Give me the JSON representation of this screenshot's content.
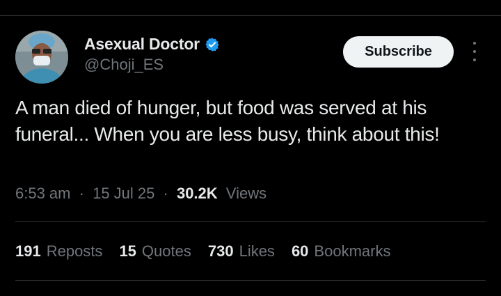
{
  "author": {
    "display_name": "Asexual Doctor",
    "handle": "@Choji_ES",
    "verified_icon": "verified-badge-icon",
    "verified_color": "#1d9bf0"
  },
  "actions": {
    "subscribe_label": "Subscribe",
    "more_icon": "more-vertical-icon"
  },
  "tweet": {
    "text": "A man died of hunger, but food was served at his funeral... When you are less busy, think about this!"
  },
  "meta": {
    "time": "6:53 am",
    "separator": "·",
    "date": "15 Jul 25",
    "views_count": "30.2K",
    "views_label": "Views"
  },
  "stats": [
    {
      "count": "191",
      "label": "Reposts"
    },
    {
      "count": "15",
      "label": "Quotes"
    },
    {
      "count": "730",
      "label": "Likes"
    },
    {
      "count": "60",
      "label": "Bookmarks"
    }
  ],
  "colors": {
    "background": "#000000",
    "text_primary": "#e7e9ea",
    "text_secondary": "#71767b",
    "divider": "#2f3336",
    "button_bg": "#eff3f4"
  }
}
